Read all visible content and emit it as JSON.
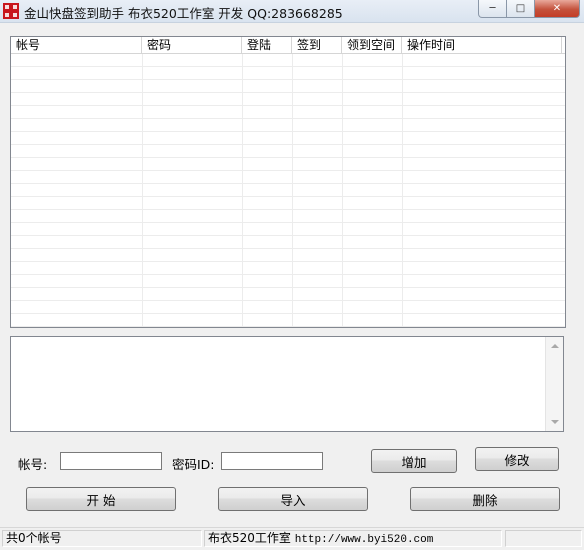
{
  "window": {
    "title": "金山快盘签到助手  布衣520工作室 开发 QQ:283668285",
    "controls": {
      "minimize": "─",
      "maximize": "□",
      "close": "✕"
    }
  },
  "list": {
    "columns": [
      "帐号",
      "密码",
      "登陆",
      "签到",
      "领到空间",
      "操作时间"
    ],
    "rows": []
  },
  "log": {
    "text": ""
  },
  "form": {
    "account_label": "帐号:",
    "account_value": "",
    "password_label": "密码ID:",
    "password_value": ""
  },
  "buttons": {
    "add": "增加",
    "modify": "修改",
    "start": "开 始",
    "import": "导入",
    "delete": "删除"
  },
  "status": {
    "count": "共0个帐号",
    "studio": "布衣520工作室",
    "url": "http://www.byi520.com",
    "extra": ""
  }
}
